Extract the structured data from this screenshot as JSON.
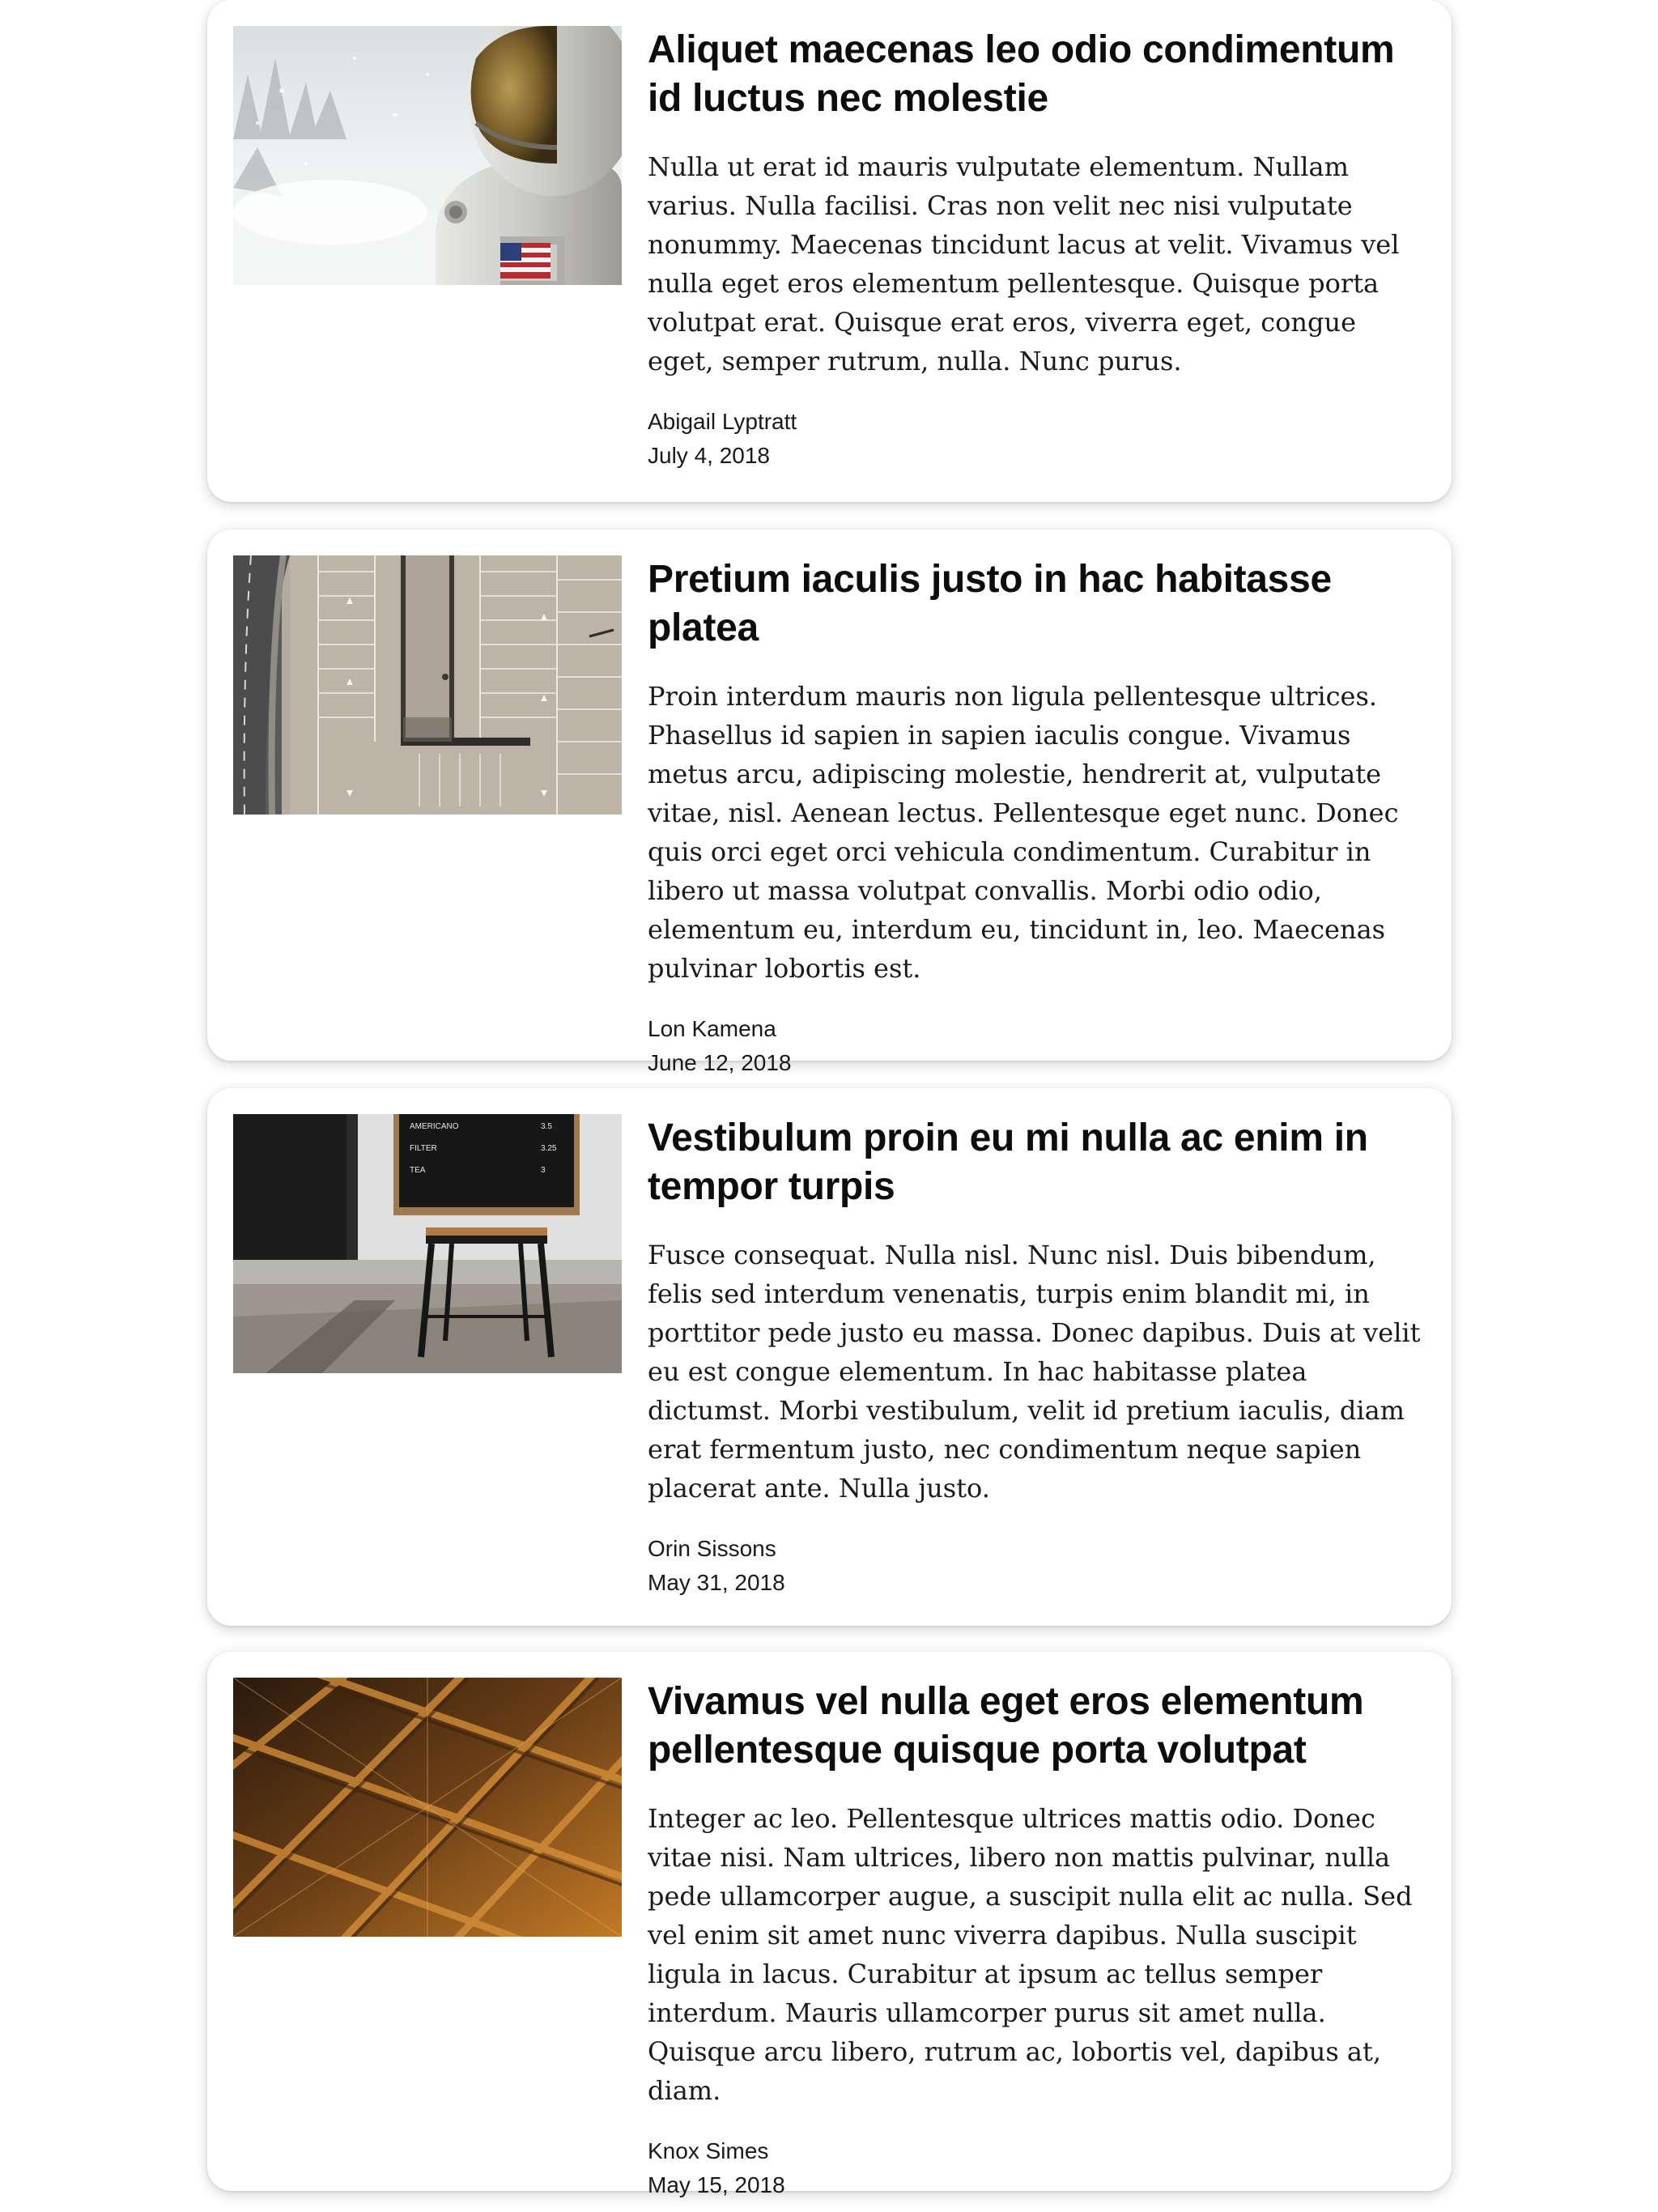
{
  "articles": [
    {
      "image": "astronaut-photo",
      "title": "Aliquet maecenas leo odio condimentum id luctus nec molestie",
      "body": "Nulla ut erat id mauris vulputate elementum. Nullam varius. Nulla facilisi. Cras non velit nec nisi vulputate nonummy. Maecenas tincidunt lacus at velit. Vivamus vel nulla eget eros elementum pellentesque. Quisque porta volutpat erat. Quisque erat eros, viverra eget, congue eget, semper rutrum, nulla. Nunc purus.",
      "author": "Abigail Lyptratt",
      "date": "July 4, 2018"
    },
    {
      "image": "parking-lot-aerial-photo",
      "title": "Pretium iaculis justo in hac habitasse platea",
      "body": "Proin interdum mauris non ligula pellentesque ultrices. Phasellus id sapien in sapien iaculis congue. Vivamus metus arcu, adipiscing molestie, hendrerit at, vulputate vitae, nisl. Aenean lectus. Pellentesque eget nunc. Donec quis orci eget orci vehicula condimentum. Curabitur in libero ut massa volutpat convallis. Morbi odio odio, elementum eu, interdum eu, tincidunt in, leo. Maecenas pulvinar lobortis est.",
      "author": "Lon Kamena",
      "date": "June 12, 2018"
    },
    {
      "image": "cafe-menu-board-photo",
      "menu_board": [
        {
          "item": "AMERICANO",
          "price": "3.5"
        },
        {
          "item": "FILTER",
          "price": "3.25"
        },
        {
          "item": "TEA",
          "price": "3"
        }
      ],
      "title": "Vestibulum proin eu mi nulla ac enim in tempor turpis",
      "body": "Fusce consequat. Nulla nisl. Nunc nisl. Duis bibendum, felis sed interdum venenatis, turpis enim blandit mi, in porttitor pede justo eu massa. Donec dapibus. Duis at velit eu est congue elementum. In hac habitasse platea dictumst. Morbi vestibulum, velit id pretium iaculis, diam erat fermentum justo, nec condimentum neque sapien placerat ante. Nulla justo.",
      "author": "Orin Sissons",
      "date": "May 31, 2018"
    },
    {
      "image": "geometric-ceiling-photo",
      "title": "Vivamus vel nulla eget eros elementum pellentesque quisque porta volutpat",
      "body": "Integer ac leo. Pellentesque ultrices mattis odio. Donec vitae nisi. Nam ultrices, libero non mattis pulvinar, nulla pede ullamcorper augue, a suscipit nulla elit ac nulla. Sed vel enim sit amet nunc viverra dapibus. Nulla suscipit ligula in lacus. Curabitur at ipsum ac tellus semper interdum. Mauris ullamcorper purus sit amet nulla. Quisque arcu libero, rutrum ac, lobortis vel, dapibus at, diam.",
      "author": "Knox Simes",
      "date": "May 15, 2018"
    }
  ]
}
